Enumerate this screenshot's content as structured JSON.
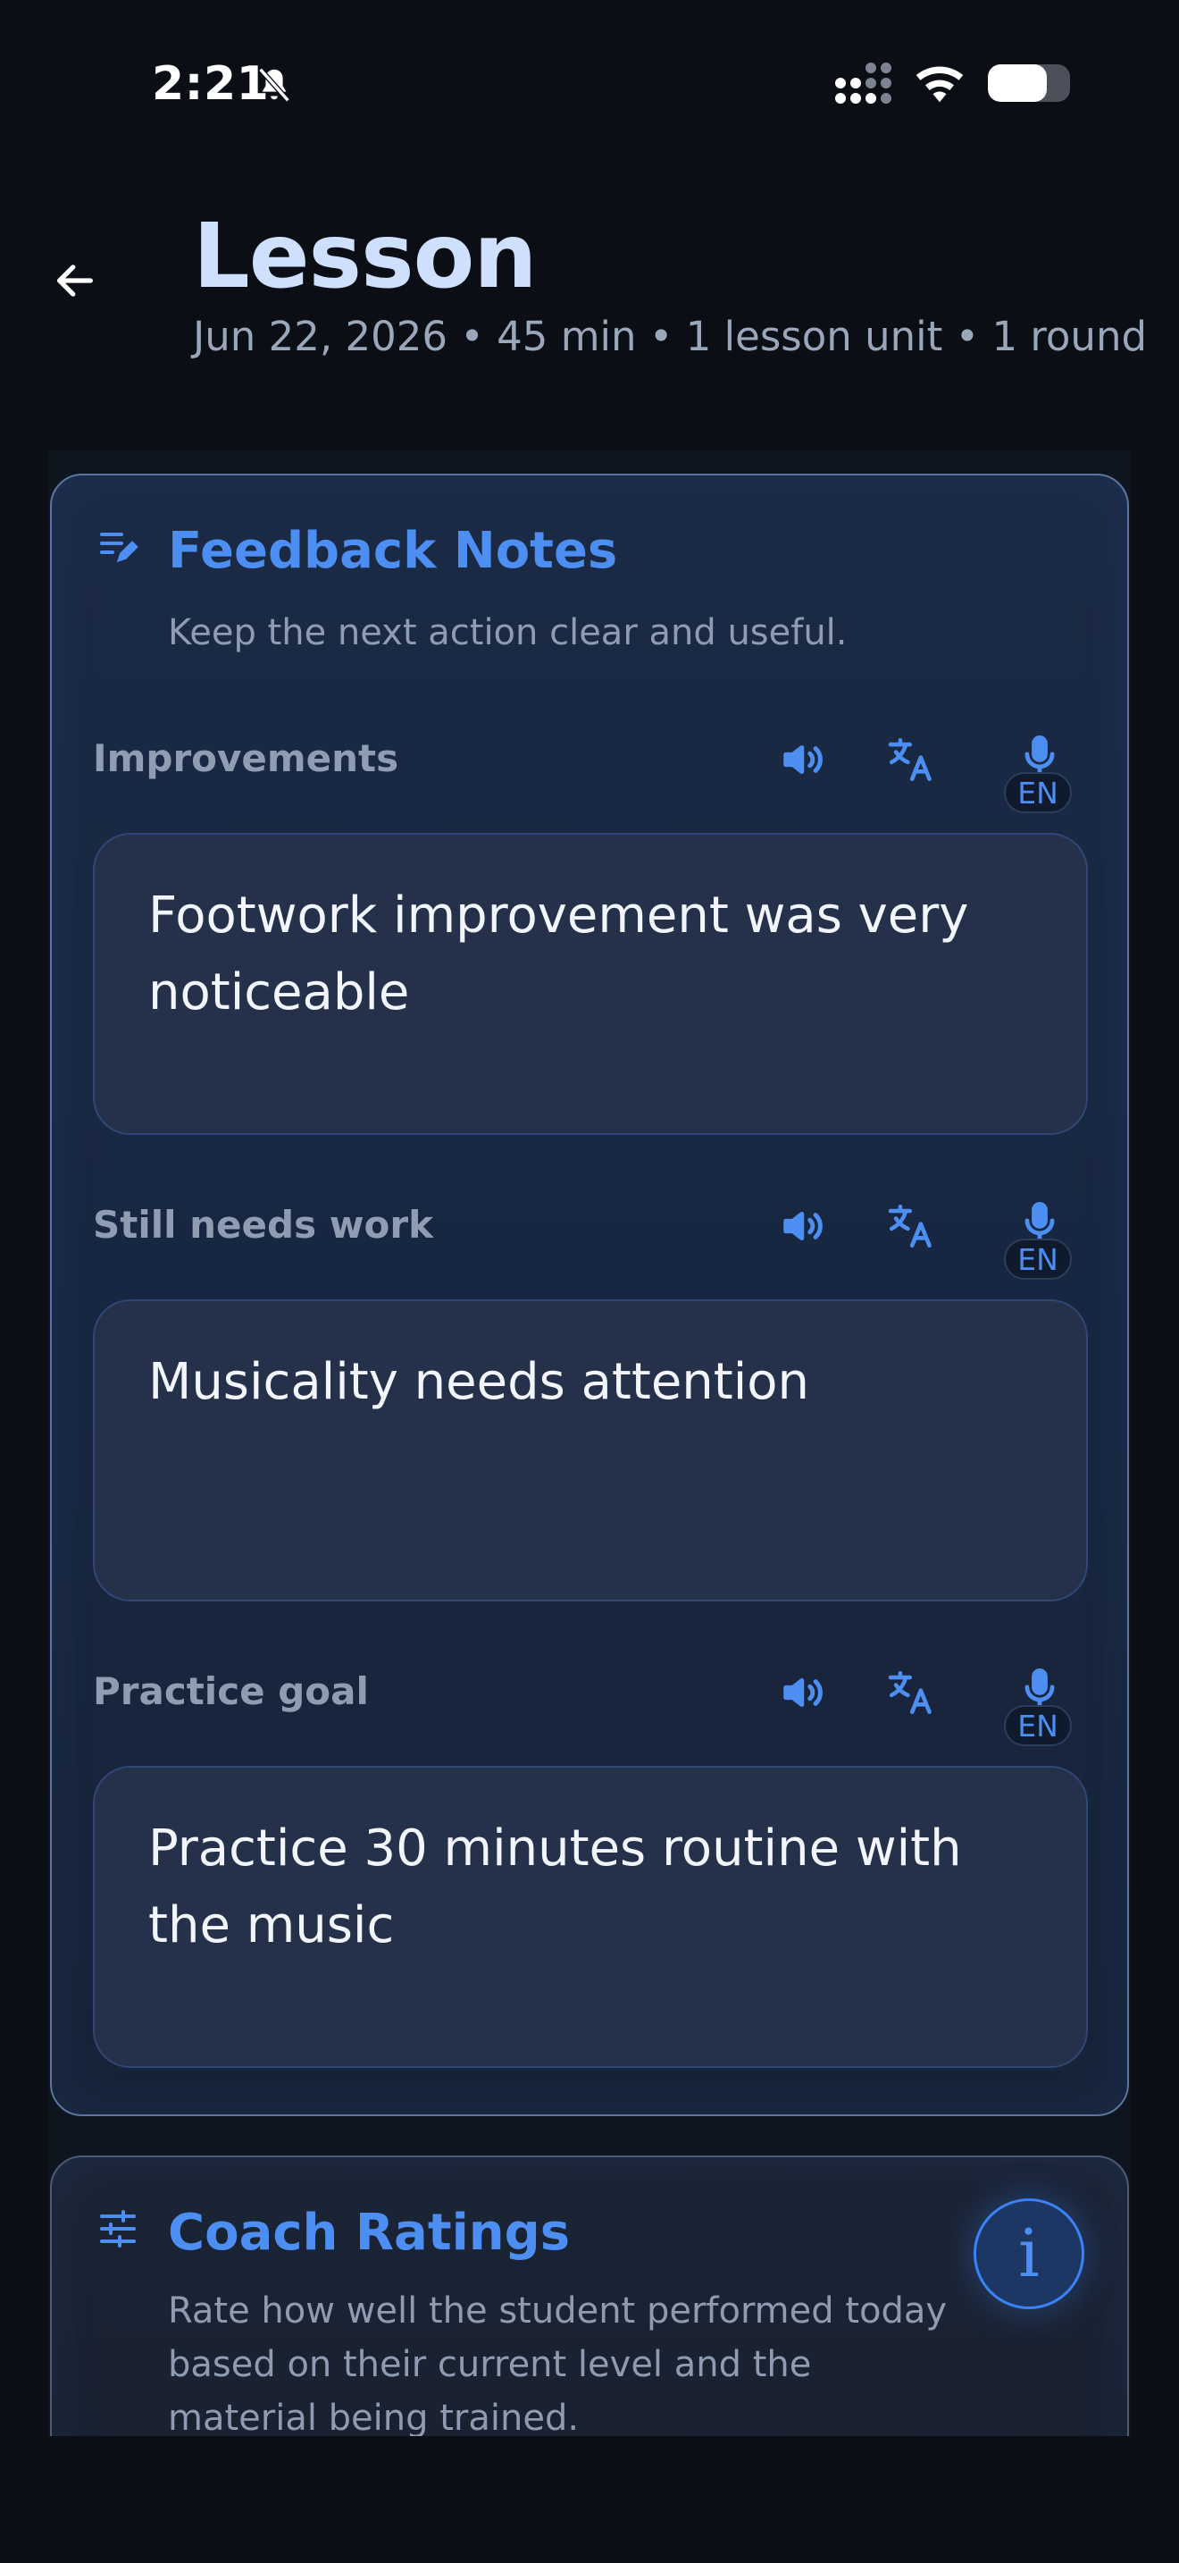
{
  "status_bar": {
    "time": "2:21",
    "battery_level": 0.72
  },
  "header": {
    "title": "Lesson",
    "subtitle": "Jun 22, 2026 • 45 min • 1 lesson unit • 1 round"
  },
  "feedback_notes": {
    "title": "Feedback Notes",
    "description": "Keep the next action clear and useful.",
    "language_badge": "EN",
    "sections": [
      {
        "label": "Improvements",
        "text": "Footwork improvement was very noticeable"
      },
      {
        "label": "Still needs work",
        "text": "Musicality needs attention"
      },
      {
        "label": "Practice goal",
        "text": "Practice 30 minutes routine with the music"
      }
    ]
  },
  "coach_ratings": {
    "title": "Coach Ratings",
    "description": "Rate how well the student performed today based on their current level and the material being trained.",
    "info_label": "i"
  },
  "colors": {
    "accent": "#4d8ef2",
    "background": "#0b0f15",
    "card": "#1b2a44",
    "field": "#25314a",
    "title": "#cfe0ff"
  }
}
